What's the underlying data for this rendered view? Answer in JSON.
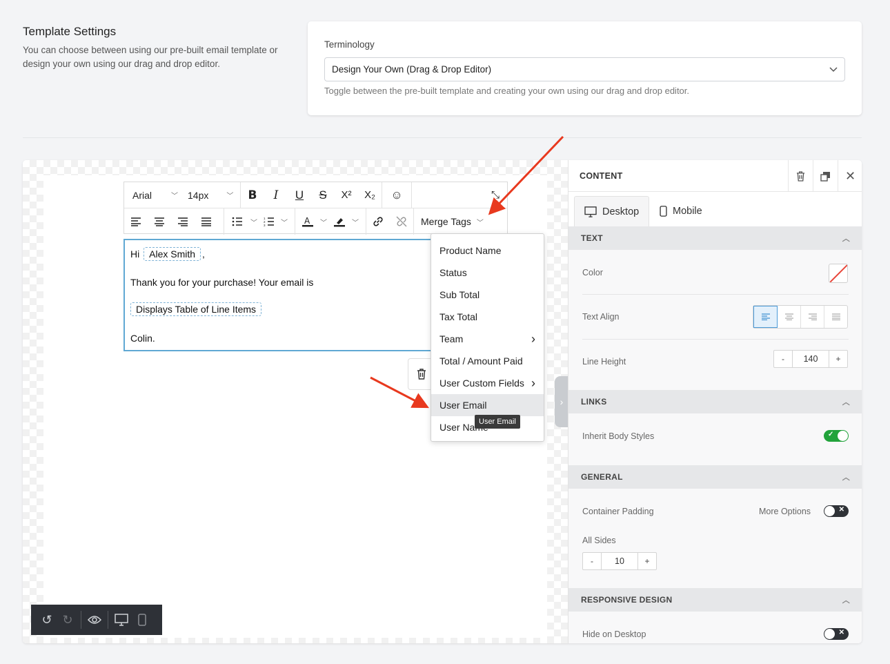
{
  "template_settings": {
    "title": "Template Settings",
    "description": "You can choose between using our pre-built email template or design your own using our drag and drop editor."
  },
  "terminology": {
    "label": "Terminology",
    "selected": "Design Your Own (Drag & Drop Editor)",
    "help": "Toggle between the pre-built template and creating your own using our drag and drop editor."
  },
  "toolbar": {
    "font": "Arial",
    "size": "14px",
    "merge_tags": "Merge Tags"
  },
  "content": {
    "greeting": "Hi",
    "name_tag": "Alex Smith",
    "comma": ",",
    "line2": "Thank you for your purchase! Your email is",
    "table_tag": "Displays Table of Line Items",
    "signoff": "Colin."
  },
  "merge_menu": [
    {
      "label": "Product Name",
      "submenu": false
    },
    {
      "label": "Status",
      "submenu": false
    },
    {
      "label": "Sub Total",
      "submenu": false
    },
    {
      "label": "Tax Total",
      "submenu": false
    },
    {
      "label": "Team",
      "submenu": true
    },
    {
      "label": "Total / Amount Paid",
      "submenu": false
    },
    {
      "label": "User Custom Fields",
      "submenu": true
    },
    {
      "label": "User Email",
      "submenu": false
    },
    {
      "label": "User Name",
      "submenu": false
    }
  ],
  "tooltip": "User Email",
  "panel": {
    "title": "CONTENT",
    "tab_desktop": "Desktop",
    "tab_mobile": "Mobile",
    "text_section": "TEXT",
    "color_label": "Color",
    "text_align_label": "Text Align",
    "line_height_label": "Line Height",
    "line_height_value": "140",
    "links_section": "LINKS",
    "inherit_label": "Inherit Body Styles",
    "general_section": "GENERAL",
    "padding_label": "Container Padding",
    "more_options": "More Options",
    "all_sides": "All Sides",
    "padding_value": "10",
    "responsive_section": "RESPONSIVE DESIGN",
    "hide_desktop": "Hide on Desktop",
    "minus": "-",
    "plus": "+"
  },
  "colors": {
    "accent": "#4a9ad8",
    "toggle_on": "#22a33b",
    "annotation_arrow": "#e8391e"
  }
}
